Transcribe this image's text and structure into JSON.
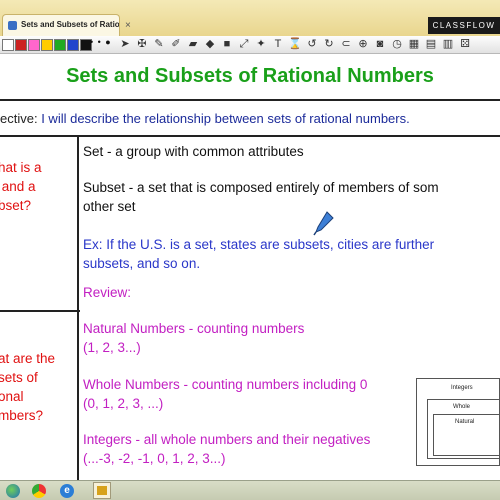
{
  "window": {
    "tab_title": "Sets and Subsets of Ratio*",
    "tab_close": "×",
    "brand": "CLASSFLOW"
  },
  "toolbar": {
    "colors": [
      "#ffffff",
      "#cc2222",
      "#ff66cc",
      "#ffcc00",
      "#22aa22",
      "#2244cc",
      "#111111"
    ],
    "dots_label": "• • ●",
    "tools": [
      {
        "name": "pointer-icon",
        "glyph": "➤"
      },
      {
        "name": "tools-icon",
        "glyph": "✠"
      },
      {
        "name": "pen-icon",
        "glyph": "✎"
      },
      {
        "name": "marker-icon",
        "glyph": "✐"
      },
      {
        "name": "eraser-icon",
        "glyph": "▰"
      },
      {
        "name": "fill-icon",
        "glyph": "◆"
      },
      {
        "name": "shape-icon",
        "glyph": "■"
      },
      {
        "name": "connector-icon",
        "glyph": "⤢"
      },
      {
        "name": "magic-icon",
        "glyph": "✦"
      },
      {
        "name": "text-icon",
        "glyph": "T"
      },
      {
        "name": "hourglass-icon",
        "glyph": "⌛"
      },
      {
        "name": "undo-icon",
        "glyph": "↺"
      },
      {
        "name": "redo-icon",
        "glyph": "↻"
      },
      {
        "name": "link-icon",
        "glyph": "⊂"
      },
      {
        "name": "zoom-icon",
        "glyph": "⊕"
      },
      {
        "name": "camera-icon",
        "glyph": "◙"
      },
      {
        "name": "clock-icon",
        "glyph": "◷"
      },
      {
        "name": "grid-icon",
        "glyph": "▦"
      },
      {
        "name": "calculator-icon",
        "glyph": "▤"
      },
      {
        "name": "keyboard-icon",
        "glyph": "▥"
      },
      {
        "name": "dice-icon",
        "glyph": "⚄"
      }
    ]
  },
  "slide": {
    "title": "Sets and Subsets of Rational Numbers",
    "objective_label": "ective:",
    "objective_text": "I will describe the relationship between sets of rational numbers.",
    "question1": "hat is a\n and a\nbset?",
    "question2": "at are the\nsets of\nonal\nmbers?",
    "set_def": "Set - a group with common attributes",
    "subset_def_1": "Subset - a set that is composed entirely of members of som",
    "subset_def_2": "other set",
    "example_1": "Ex: If the U.S. is a set, states are subsets, cities are further",
    "example_2": "subsets, and so on.",
    "review": "Review:",
    "natural_1": "Natural Numbers - counting numbers",
    "natural_2": "(1, 2, 3...)",
    "whole_1": "Whole Numbers - counting numbers including 0",
    "whole_2": "(0, 1, 2, 3, ...)",
    "integers_1": "Integers - all whole numbers and their negatives",
    "integers_2": "(...-3, -2, -1, 0, 1, 2, 3...)"
  },
  "diagram": {
    "outer_label": "Integers",
    "middle_label": "Whole",
    "inner_label": "Natural"
  }
}
